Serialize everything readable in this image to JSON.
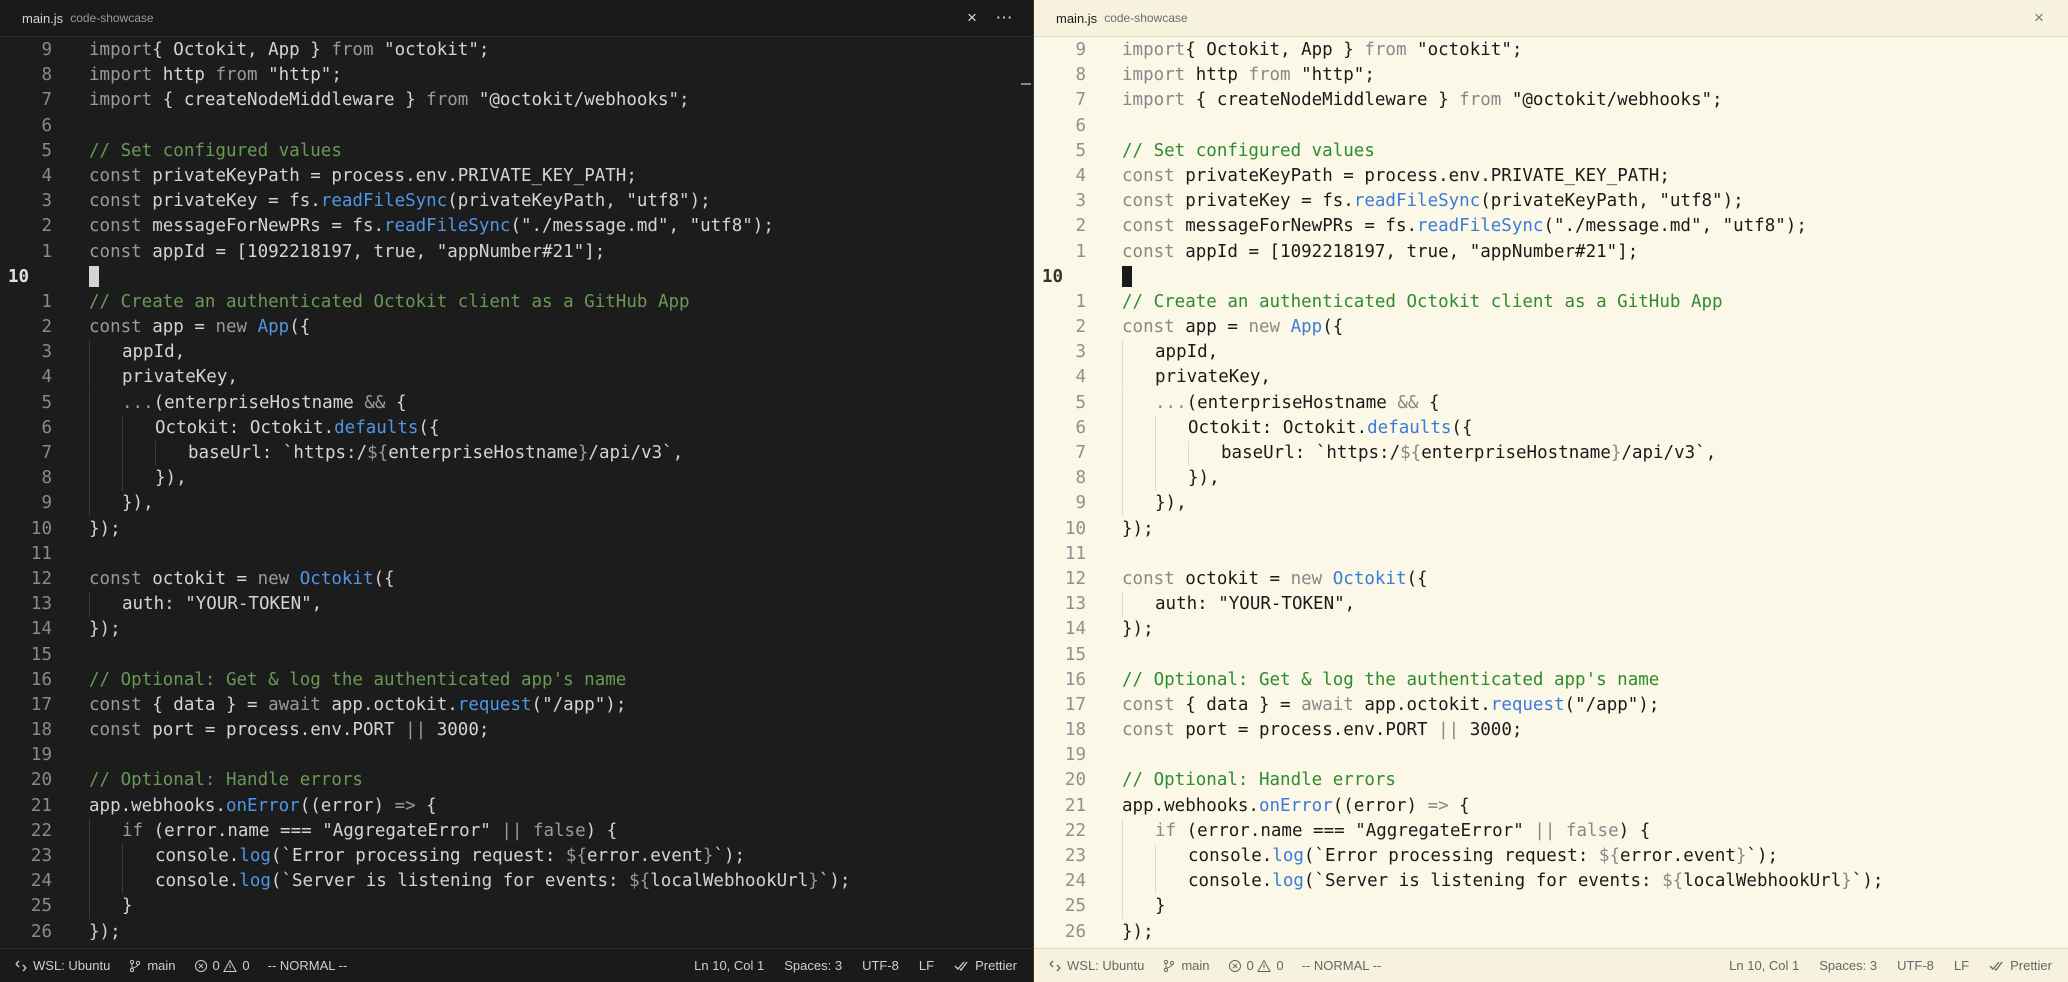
{
  "tab": {
    "filename": "main.js",
    "folder": "code-showcase",
    "close_icon": "×",
    "more_icon": "⋯"
  },
  "status": {
    "remote": "WSL: Ubuntu",
    "branch": "main",
    "errors": "0",
    "warnings": "0",
    "mode": "-- NORMAL --",
    "position": "Ln 10, Col 1",
    "spaces": "Spaces: 3",
    "encoding": "UTF-8",
    "eol": "LF",
    "formatter": "Prettier"
  },
  "theme_colors": {
    "dark_bg": "#1c1c1c",
    "light_bg": "#fbf8e8",
    "keyword": "#9a9a9a",
    "function": "#4f97e6",
    "comment": "#6a9955"
  },
  "lines": [
    {
      "n": "9",
      "ind": 0,
      "t": [
        [
          "kw",
          "import"
        ],
        [
          "",
          "{ Octokit, App } "
        ],
        [
          "kw",
          "from"
        ],
        [
          "",
          " \"octokit\";"
        ]
      ]
    },
    {
      "n": "8",
      "ind": 0,
      "t": [
        [
          "kw",
          "import"
        ],
        [
          "",
          " http "
        ],
        [
          "kw",
          "from"
        ],
        [
          "",
          " \"http\";"
        ]
      ]
    },
    {
      "n": "7",
      "ind": 0,
      "t": [
        [
          "kw",
          "import"
        ],
        [
          "",
          " { createNodeMiddleware } "
        ],
        [
          "kw",
          "from"
        ],
        [
          "",
          " \"@octokit/webhooks\";"
        ]
      ]
    },
    {
      "n": "6",
      "ind": 0,
      "t": []
    },
    {
      "n": "5",
      "ind": 0,
      "t": [
        [
          "cm",
          "// Set configured values"
        ]
      ]
    },
    {
      "n": "4",
      "ind": 0,
      "t": [
        [
          "kw",
          "const"
        ],
        [
          "",
          " privateKeyPath = process.env.PRIVATE_KEY_PATH;"
        ]
      ]
    },
    {
      "n": "3",
      "ind": 0,
      "t": [
        [
          "kw",
          "const"
        ],
        [
          "",
          " privateKey = fs."
        ],
        [
          "fn",
          "readFileSync"
        ],
        [
          "",
          "(privateKeyPath, \"utf8\");"
        ]
      ]
    },
    {
      "n": "2",
      "ind": 0,
      "t": [
        [
          "kw",
          "const"
        ],
        [
          "",
          " messageForNewPRs = fs."
        ],
        [
          "fn",
          "readFileSync"
        ],
        [
          "",
          "(\"./message.md\", \"utf8\");"
        ]
      ]
    },
    {
      "n": "1",
      "ind": 0,
      "t": [
        [
          "kw",
          "const"
        ],
        [
          "",
          " appId = [1092218197, true, \"appNumber#21\"];"
        ]
      ]
    },
    {
      "n": "10",
      "ind": 0,
      "cur": true,
      "t": []
    },
    {
      "n": "1",
      "ind": 0,
      "t": [
        [
          "cm",
          "// Create an authenticated Octokit client as a GitHub App"
        ]
      ]
    },
    {
      "n": "2",
      "ind": 0,
      "t": [
        [
          "kw",
          "const"
        ],
        [
          "",
          " app = "
        ],
        [
          "kw",
          "new"
        ],
        [
          "",
          " "
        ],
        [
          "fn",
          "App"
        ],
        [
          "",
          "({"
        ]
      ]
    },
    {
      "n": "3",
      "ind": 1,
      "t": [
        [
          "",
          "appId,"
        ]
      ]
    },
    {
      "n": "4",
      "ind": 1,
      "t": [
        [
          "",
          "privateKey,"
        ]
      ]
    },
    {
      "n": "5",
      "ind": 1,
      "t": [
        [
          "op",
          "..."
        ],
        [
          "",
          "(enterpriseHostname "
        ],
        [
          "op",
          "&&"
        ],
        [
          "",
          " {"
        ]
      ]
    },
    {
      "n": "6",
      "ind": 2,
      "t": [
        [
          "",
          "Octokit: Octokit."
        ],
        [
          "fn",
          "defaults"
        ],
        [
          "",
          "({"
        ]
      ]
    },
    {
      "n": "7",
      "ind": 3,
      "t": [
        [
          "",
          "baseUrl: `https:/"
        ],
        [
          "op",
          "${"
        ],
        [
          "",
          "enterpriseHostname"
        ],
        [
          "op",
          "}"
        ],
        [
          "",
          "/api/v3`,"
        ]
      ]
    },
    {
      "n": "8",
      "ind": 2,
      "t": [
        [
          "",
          "}),"
        ]
      ]
    },
    {
      "n": "9",
      "ind": 1,
      "t": [
        [
          "",
          "}),"
        ]
      ]
    },
    {
      "n": "10",
      "ind": 0,
      "t": [
        [
          "",
          "});"
        ]
      ]
    },
    {
      "n": "11",
      "ind": 0,
      "t": []
    },
    {
      "n": "12",
      "ind": 0,
      "t": [
        [
          "kw",
          "const"
        ],
        [
          "",
          " octokit = "
        ],
        [
          "kw",
          "new"
        ],
        [
          "",
          " "
        ],
        [
          "fn",
          "Octokit"
        ],
        [
          "",
          "({"
        ]
      ]
    },
    {
      "n": "13",
      "ind": 1,
      "t": [
        [
          "",
          "auth: \"YOUR-TOKEN\","
        ]
      ]
    },
    {
      "n": "14",
      "ind": 0,
      "t": [
        [
          "",
          "});"
        ]
      ]
    },
    {
      "n": "15",
      "ind": 0,
      "t": []
    },
    {
      "n": "16",
      "ind": 0,
      "t": [
        [
          "cm",
          "// Optional: Get & log the authenticated app's name"
        ]
      ]
    },
    {
      "n": "17",
      "ind": 0,
      "t": [
        [
          "kw",
          "const"
        ],
        [
          "",
          " { data } = "
        ],
        [
          "kw",
          "await"
        ],
        [
          "",
          " app.octokit."
        ],
        [
          "fn",
          "request"
        ],
        [
          "",
          "(\"/app\");"
        ]
      ]
    },
    {
      "n": "18",
      "ind": 0,
      "t": [
        [
          "kw",
          "const"
        ],
        [
          "",
          " port = process.env.PORT "
        ],
        [
          "op",
          "||"
        ],
        [
          "",
          " 3000;"
        ]
      ]
    },
    {
      "n": "19",
      "ind": 0,
      "t": []
    },
    {
      "n": "20",
      "ind": 0,
      "t": [
        [
          "cm",
          "// Optional: Handle errors"
        ]
      ]
    },
    {
      "n": "21",
      "ind": 0,
      "t": [
        [
          "",
          "app.webhooks."
        ],
        [
          "fn",
          "onError"
        ],
        [
          "",
          "((error) "
        ],
        [
          "op",
          "=>"
        ],
        [
          "",
          " {"
        ]
      ]
    },
    {
      "n": "22",
      "ind": 1,
      "t": [
        [
          "kw",
          "if"
        ],
        [
          "",
          " (error.name === \"AggregateError\" "
        ],
        [
          "op",
          "||"
        ],
        [
          "",
          " "
        ],
        [
          "kw",
          "false"
        ],
        [
          "",
          ") {"
        ]
      ]
    },
    {
      "n": "23",
      "ind": 2,
      "t": [
        [
          "",
          "console."
        ],
        [
          "fn",
          "log"
        ],
        [
          "",
          "(`Error processing request: "
        ],
        [
          "op",
          "${"
        ],
        [
          "",
          "error.event"
        ],
        [
          "op",
          "}"
        ],
        [
          "",
          "`);"
        ]
      ]
    },
    {
      "n": "24",
      "ind": 2,
      "t": [
        [
          "",
          "console."
        ],
        [
          "fn",
          "log"
        ],
        [
          "",
          "(`Server is listening for events: "
        ],
        [
          "op",
          "${"
        ],
        [
          "",
          "localWebhookUrl"
        ],
        [
          "op",
          "}"
        ],
        [
          "",
          "`);"
        ]
      ]
    },
    {
      "n": "25",
      "ind": 1,
      "t": [
        [
          "",
          "}"
        ]
      ]
    },
    {
      "n": "26",
      "ind": 0,
      "t": [
        [
          "",
          "});"
        ]
      ]
    }
  ]
}
